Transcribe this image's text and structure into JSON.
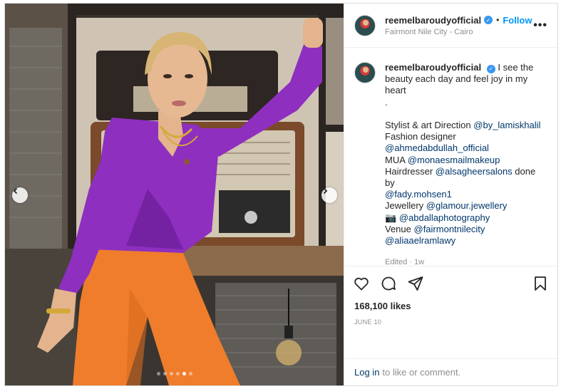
{
  "post": {
    "username": "reemelbaroudyofficial",
    "separator": "•",
    "follow_label": "Follow",
    "location": "Fairmont Nile City - Cairo",
    "more_label": "•••"
  },
  "caption": {
    "lines": [
      "I see the",
      "beauty each day and feel joy in my heart",
      ".",
      "",
      "Stylist & art Direction @by_lamiskhalil",
      "Fashion designer",
      "@ahmedabdullah_official",
      "MUA @monaesmailmakeup",
      "Hairdresser @alsagheersalons done by",
      "@fady.mohsen1",
      "Jewellery @glamour.jewellery",
      "📷 @abdallaphotography",
      "Venue @fairmontnilecity",
      "@aliaaelramlawy"
    ],
    "edited": "Edited · 1w"
  },
  "engagement": {
    "likes": "168,100 likes",
    "date": "JUNE 10",
    "login_link": "Log in",
    "login_text": "to like or comment."
  },
  "carousel": {
    "total": 6,
    "active_index": 4
  },
  "icons": {
    "verified": "verified-badge-icon",
    "like": "heart-icon",
    "comment": "comment-icon",
    "share": "send-icon",
    "save": "bookmark-icon",
    "load_more": "plus-circle-icon"
  },
  "colors": {
    "accent": "#0095f6",
    "verified": "#3897f0",
    "muted": "#8e8e8e",
    "mention": "#00376b",
    "top_color": "#8e2fc0",
    "pants_color": "#ef7d2b"
  }
}
